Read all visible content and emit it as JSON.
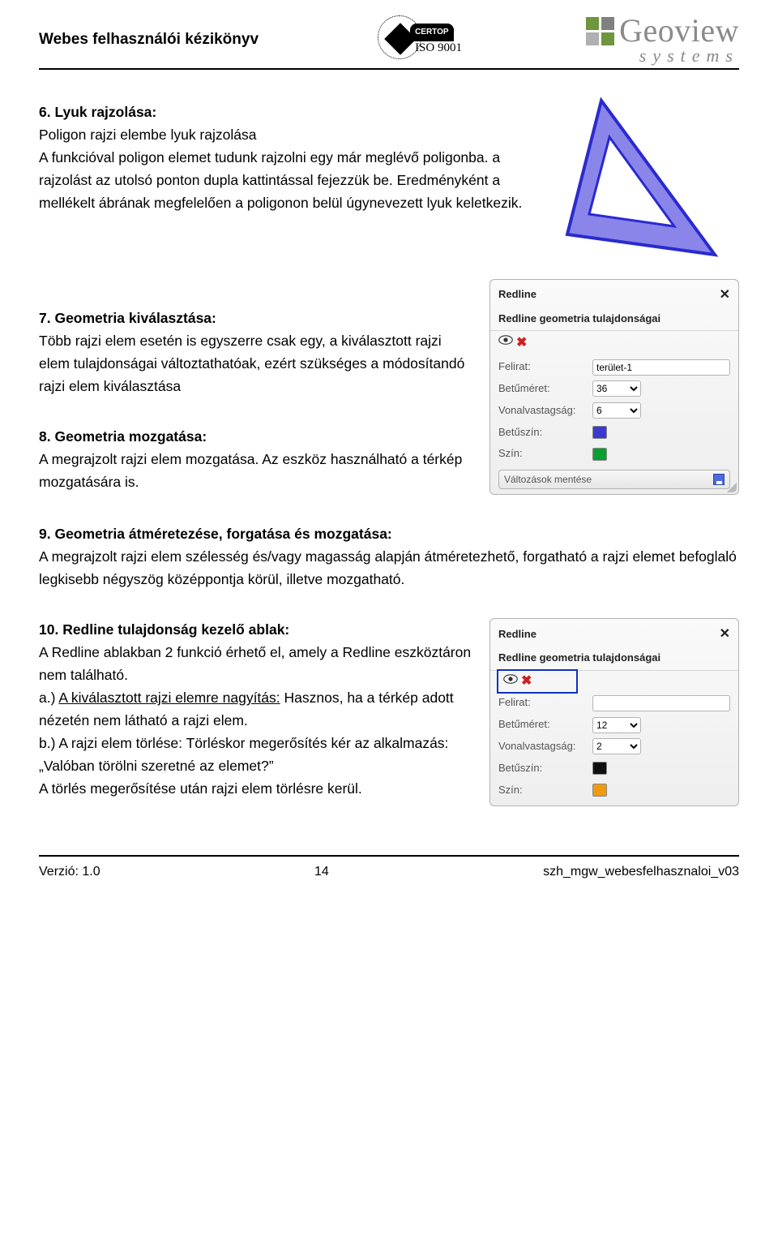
{
  "header": {
    "doc_title": "Webes felhasználói kézikönyv",
    "certop_label": "CERTOP",
    "iso_label": "ISO 9001",
    "logo_name": "Geoview",
    "logo_sub": "systems"
  },
  "s6": {
    "heading": "6. Lyuk rajzolása:",
    "p1": "Poligon rajzi elembe lyuk rajzolása",
    "p2": "A funkcióval poligon elemet tudunk rajzolni egy már meglévő poligonba. a rajzolást az utolsó ponton dupla kattintással fejezzük be. Eredményként a mellékelt ábrának megfelelően a poligonon belül úgynevezett lyuk keletkezik."
  },
  "s7": {
    "heading": "7. Geometria kiválasztása:",
    "p1": "Több rajzi elem esetén is egyszerre csak egy, a kiválasztott rajzi elem tulajdonságai változtathatóak, ezért szükséges a módosítandó rajzi elem kiválasztása"
  },
  "s8": {
    "heading": "8. Geometria mozgatása:",
    "p1": "A megrajzolt rajzi elem mozgatása. Az eszköz használható a térkép mozgatására is."
  },
  "s9": {
    "heading": "9. Geometria átméretezése, forgatása és mozgatása:",
    "p1": "A megrajzolt rajzi elem szélesség és/vagy magasság alapján átméretezhető, forgatható a rajzi elemet befoglaló legkisebb négyszög középpontja körül, illetve mozgatható."
  },
  "s10": {
    "heading": "10. Redline tulajdonság kezelő ablak:",
    "p1": "A Redline ablakban 2 funkció érhető el, amely a Redline eszköztáron nem található.",
    "p2a_label": "a.) ",
    "p2a_underlined": "A kiválasztott rajzi elemre nagyítás:",
    "p2a_rest": " Hasznos, ha a térkép adott nézetén nem látható a rajzi elem.",
    "p3": "b.) A rajzi elem törlése: Törléskor megerősítés kér az alkalmazás: „Valóban törölni szeretné az elemet?”",
    "p4": "A törlés megerősítése után rajzi elem törlésre kerül."
  },
  "panel1": {
    "title": "Redline",
    "subtitle": "Redline geometria tulajdonságai",
    "lbl_felirat": "Felirat:",
    "val_felirat": "terület-1",
    "lbl_betumeret": "Betűméret:",
    "val_betumeret": "36",
    "lbl_vonal": "Vonalvastagság:",
    "val_vonal": "6",
    "lbl_betuszin": "Betűszín:",
    "col_betuszin": "#3a3ad0",
    "lbl_szin": "Szín:",
    "col_szin": "#0aa030",
    "save_label": "Változások mentése"
  },
  "panel2": {
    "title": "Redline",
    "subtitle": "Redline geometria tulajdonságai",
    "lbl_felirat": "Felirat:",
    "val_felirat": "",
    "lbl_betumeret": "Betűméret:",
    "val_betumeret": "12",
    "lbl_vonal": "Vonalvastagság:",
    "val_vonal": "2",
    "lbl_betuszin": "Betűszín:",
    "col_betuszin": "#101010",
    "lbl_szin": "Szín:",
    "col_szin": "#f09a10"
  },
  "footer": {
    "version": "Verzió: 1.0",
    "page": "14",
    "docid": "szh_mgw_webesfelhasznaloi_v03"
  }
}
